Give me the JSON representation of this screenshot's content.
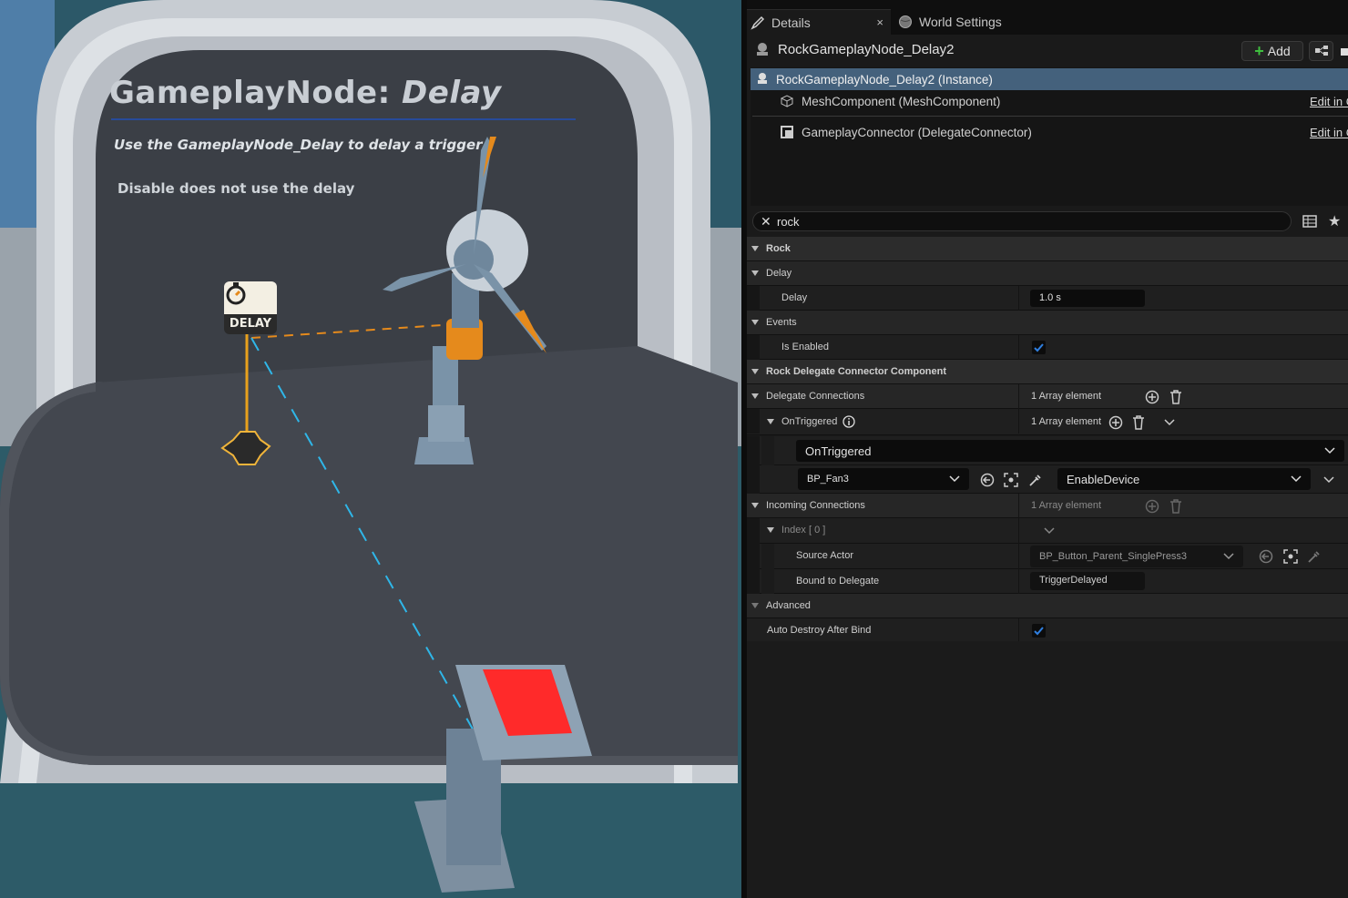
{
  "viewport": {
    "title_prefix": "GameplayNode: ",
    "title_emph": "Delay",
    "line1": "Use the GameplayNode_Delay to delay a trigger",
    "line2": "Disable does not use the delay",
    "badge_label": "DELAY",
    "icons": [
      "stopwatch-icon"
    ]
  },
  "tabs": {
    "details": "Details",
    "close": "×",
    "world_settings": "World Settings"
  },
  "actor": {
    "name": "RockGameplayNode_Delay2",
    "add_label": "Add"
  },
  "components": {
    "instance": "RockGameplayNode_Delay2 (Instance)",
    "children": [
      {
        "label": "MeshComponent (MeshComponent)",
        "link": "Edit in C++"
      },
      {
        "label": "GameplayConnector (DelegateConnector)",
        "link": "Edit in C++"
      }
    ]
  },
  "search": {
    "value": "rock"
  },
  "props": {
    "rock": "Rock",
    "delay_cat": "Delay",
    "delay_label": "Delay",
    "delay_value": "1.0 s",
    "events_cat": "Events",
    "is_enabled": "Is Enabled",
    "is_enabled_checked": true,
    "rdcc": "Rock Delegate Connector Component",
    "delegate_connections": "Delegate Connections",
    "delegate_connections_value": "1 Array element",
    "on_triggered": "OnTriggered",
    "on_triggered_value": "1 Array element",
    "on_triggered_combo": "OnTriggered",
    "target_actor": "BP_Fan3",
    "target_function": "EnableDevice",
    "incoming_connections": "Incoming Connections",
    "incoming_value": "1 Array element",
    "index": "Index [ 0 ]",
    "source_actor": "Source Actor",
    "source_actor_value": "BP_Button_Parent_SinglePress3",
    "bound_to_delegate": "Bound to Delegate",
    "bound_value": "TriggerDelayed",
    "advanced": "Advanced",
    "auto_destroy": "Auto Destroy After Bind",
    "auto_destroy_checked": true
  },
  "colors": {
    "selection": "#44617c",
    "check": "#2f7fe0",
    "add_plus": "#3fbf3f",
    "viewport_wall": "#3a3e45",
    "button_red": "#ff2a2a",
    "fan_orange": "#e58a1c"
  }
}
